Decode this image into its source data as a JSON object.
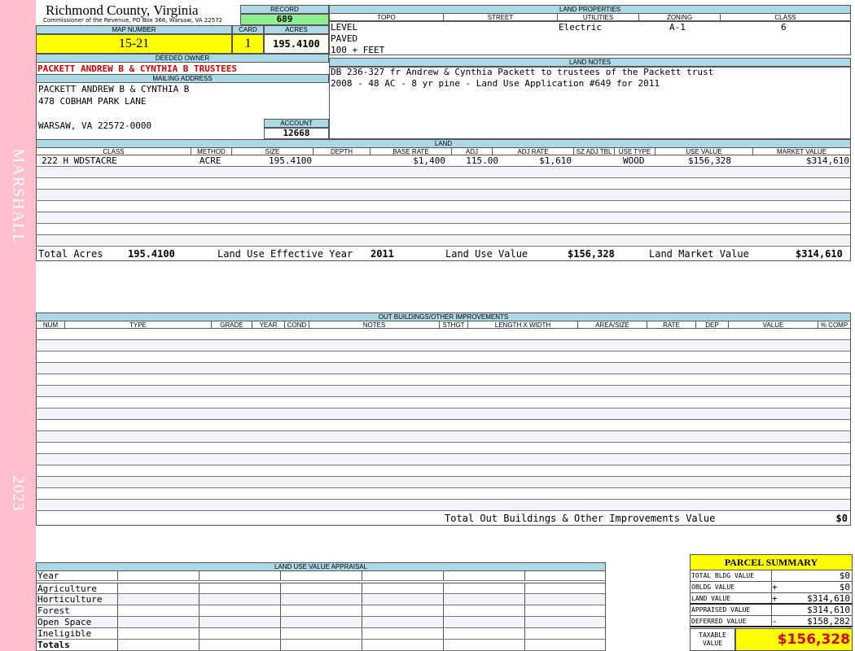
{
  "side": {
    "top": "MARSHALL",
    "bottom": "2023"
  },
  "header": {
    "county": "Richmond County, Virginia",
    "address": "Commissioner of the Revenue, PO Box 366, Warsaw, VA 22572"
  },
  "record": {
    "label": "RECORD",
    "value": "689"
  },
  "map": {
    "label": "MAP NUMBER",
    "value": "15-21"
  },
  "card": {
    "label": "CARD",
    "value": "1"
  },
  "acres": {
    "label": "ACRES",
    "value": "195.4100"
  },
  "owner": {
    "label": "DEEDED OWNER",
    "value": "PACKETT ANDREW B & CYNTHIA B TRUSTEES"
  },
  "mailing": {
    "label": "MAILING ADDRESS",
    "line1": "PACKETT ANDREW B & CYNTHIA B",
    "line2": "478 COBHAM PARK LANE",
    "line3": "WARSAW, VA 22572-0000"
  },
  "account": {
    "label": "ACCOUNT",
    "value": "12668"
  },
  "land_props": {
    "label": "LAND PROPERTIES",
    "cols": [
      "TOPO",
      "STREET",
      "UTILITIES",
      "ZONING",
      "CLASS"
    ],
    "topo": [
      "LEVEL",
      "PAVED",
      "100 + FEET"
    ],
    "utilities": "Electric",
    "zoning": "A-1",
    "class": "6"
  },
  "land_notes": {
    "label": "LAND NOTES",
    "line1": "DB 236-327 fr Andrew & Cynthia Packett to trustees of the Packett trust",
    "line2": "2008 - 48 AC - 8 yr pine - Land Use Application #649 for 2011"
  },
  "land": {
    "label": "LAND",
    "cols": [
      "CLASS",
      "METHOD",
      "SIZE",
      "DEPTH",
      "BASE RATE",
      "ADJ",
      "ADJ RATE",
      "SZ ADJ TBL",
      "USE TYPE",
      "USE VALUE",
      "MARKET VALUE"
    ],
    "row": {
      "class": "222 H WDSTACRE",
      "method": "ACRE",
      "size": "195.4100",
      "depth": "",
      "base_rate": "$1,400",
      "adj": "115.00",
      "adj_rate": "$1,610",
      "sz": "",
      "use_type": "WOOD",
      "use_value": "$156,328",
      "market_value": "$314,610"
    },
    "total_acres_label": "Total Acres",
    "total_acres": "195.4100",
    "eff_year_label": "Land Use Effective Year",
    "eff_year": "2011",
    "use_value_label": "Land Use Value",
    "use_value": "$156,328",
    "market_label": "Land Market Value",
    "market_value": "$314,610"
  },
  "out": {
    "label": "OUT BUILDINGS/OTHER IMPROVEMENTS",
    "cols": [
      "NUM",
      "TYPE",
      "GRADE",
      "YEAR",
      "COND",
      "NOTES",
      "STHGT",
      "LENGTH X WIDTH",
      "AREA/SIZE",
      "RATE",
      "DEP",
      "VALUE",
      "% COMP"
    ],
    "total_label": "Total Out Buildings & Other Improvements Value",
    "total": "$0"
  },
  "luva": {
    "label": "LAND USE VALUE APPRAISAL",
    "rows": [
      "Year",
      "Agriculture",
      "Horticulture",
      "Forest",
      "Open Space",
      "Ineligible",
      "Totals"
    ]
  },
  "summary": {
    "title": "PARCEL SUMMARY",
    "rows": [
      {
        "label": "TOTAL BLDG VALUE",
        "sign": "",
        "value": "$0"
      },
      {
        "label": "OBLDG VALUE",
        "sign": "+",
        "value": "$0"
      },
      {
        "label": "LAND VALUE",
        "sign": "+",
        "value": "$314,610"
      },
      {
        "label": "APPRAISED VALUE",
        "sign": "",
        "value": "$314,610"
      },
      {
        "label": "DEFERRED VALUE",
        "sign": "-",
        "value": "$158,282"
      }
    ],
    "taxable_label1": "TAXABLE",
    "taxable_label2": "VALUE",
    "taxable": "$156,328"
  }
}
